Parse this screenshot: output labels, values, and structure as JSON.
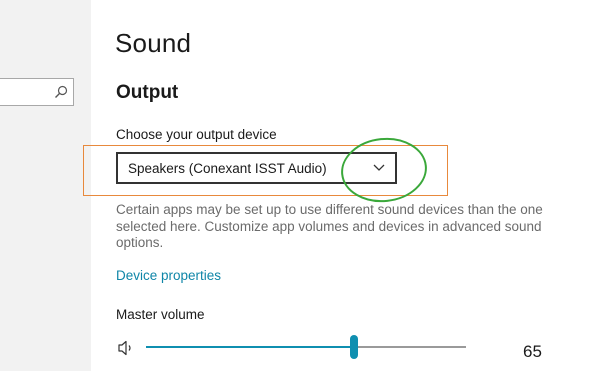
{
  "page": {
    "title": "Sound"
  },
  "output": {
    "heading": "Output",
    "device_label": "Choose your output device",
    "device_selected": "Speakers (Conexant ISST Audio)",
    "help_text": "Certain apps may be set up to use different sound devices than the one selected here. Customize app volumes and devices in advanced sound options.",
    "device_properties_link": "Device properties"
  },
  "volume": {
    "label": "Master volume",
    "value": "65",
    "level": 0.65
  },
  "icons": {
    "search": "search-icon",
    "chevron": "chevron-down-icon",
    "speaker": "speaker-icon"
  },
  "colors": {
    "accent": "#0f8fb0",
    "link": "#0f86a8",
    "highlight_box": "#e8893c",
    "annotation_circle": "#3aa83a"
  }
}
